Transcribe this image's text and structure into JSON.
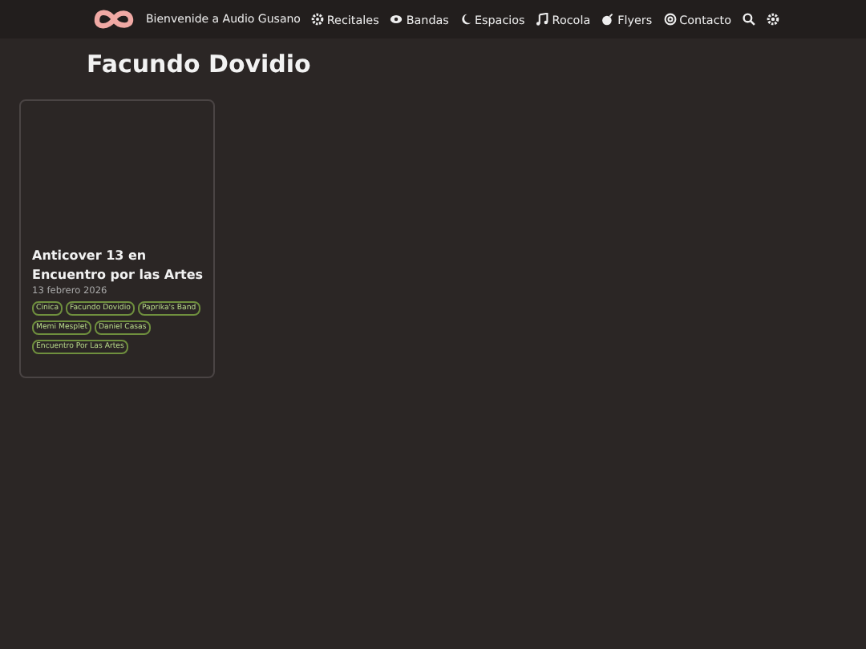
{
  "header": {
    "site_title": "Bienvenide a Audio Gusano",
    "nav": [
      {
        "label": "Recitales"
      },
      {
        "label": "Bandas"
      },
      {
        "label": "Espacios"
      },
      {
        "label": "Rocola"
      },
      {
        "label": "Flyers"
      },
      {
        "label": "Contacto"
      }
    ]
  },
  "page_title": "Facundo Dovidio",
  "cards": [
    {
      "title": "Anticover 13 en Encuentro por las Artes",
      "date": "13 febrero 2026",
      "tags": [
        "Cinica",
        "Facundo Dovidio",
        "Paprika's Band",
        "Memi Mesplet",
        "Daniel Casas",
        "Encuentro Por Las Artes"
      ]
    }
  ]
}
